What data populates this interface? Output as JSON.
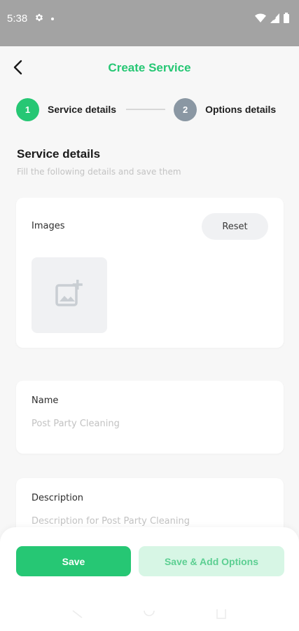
{
  "status_bar": {
    "time": "5:38"
  },
  "header": {
    "title": "Create Service"
  },
  "stepper": {
    "steps": [
      {
        "number": "1",
        "label": "Service details",
        "state": "active"
      },
      {
        "number": "2",
        "label": "Options details",
        "state": "inactive"
      }
    ]
  },
  "section": {
    "title": "Service details",
    "subtitle": "Fill the following details and save them"
  },
  "images_card": {
    "label": "Images",
    "reset_label": "Reset"
  },
  "name_card": {
    "label": "Name",
    "placeholder": "Post Party Cleaning"
  },
  "description_card": {
    "label": "Description",
    "placeholder": "Description for Post Party Cleaning"
  },
  "actions": {
    "save_label": "Save",
    "save_add_label": "Save & Add Options"
  },
  "colors": {
    "accent": "#26c774",
    "accent_light": "#d7f6e5",
    "step_inactive": "#8a97a3",
    "status_bar": "#a3a3a3"
  },
  "icons": {
    "back": "back-arrow-icon",
    "add_image": "add-photo-icon",
    "settings": "gear-icon",
    "wifi": "wifi-icon",
    "signal": "signal-icon",
    "battery": "battery-icon"
  }
}
